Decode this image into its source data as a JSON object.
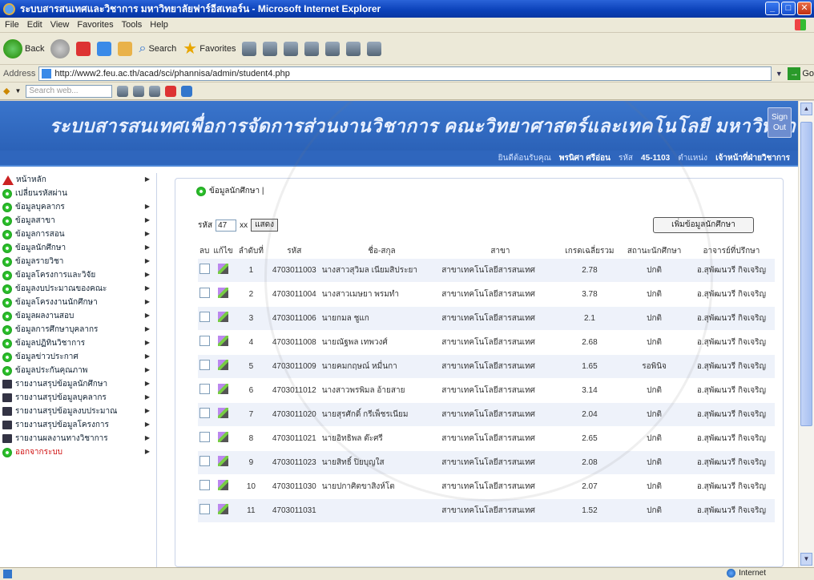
{
  "window": {
    "title": "ระบบสารสนเทศและวิชาการ มหาวิทยาลัยฟาร์อีสเทอร์น - Microsoft Internet Explorer"
  },
  "menu": [
    "File",
    "Edit",
    "View",
    "Favorites",
    "Tools",
    "Help"
  ],
  "toolbar": {
    "back": "Back",
    "search": "Search",
    "favorites": "Favorites"
  },
  "address": {
    "label": "Address",
    "url": "http://www2.feu.ac.th/acad/sci/phannisa/admin/student4.php",
    "go": "Go"
  },
  "searchbar": {
    "placeholder": "Search web..."
  },
  "status": {
    "zone": "Internet"
  },
  "site": {
    "title": "ระบบสารสนเทศเพื่อการจัดการส่วนงานวิชาการ คณะวิทยาศาสตร์และเทคโนโลยี มหาวิทยาลัยฟาร์อีสเทอร์น",
    "signout": "Sign Out"
  },
  "infobar": {
    "prefix": "ยินดีต้อนรับคุณ",
    "user": "พรนิศา ศรีอ่อน",
    "code_label": "รหัส",
    "code": "45-1103",
    "status_label": "ตำแหน่ง",
    "status": "เจ้าหน้าที่ฝ่ายวิชาการ"
  },
  "sidebar": [
    {
      "label": "หน้าหลัก",
      "icon": "home",
      "arrow": true
    },
    {
      "label": "เปลี่ยนรหัสผ่าน",
      "icon": "dot",
      "arrow": false
    },
    {
      "label": "ข้อมูลบุคลากร",
      "icon": "dot",
      "arrow": true
    },
    {
      "label": "ข้อมูลสาขา",
      "icon": "dot",
      "arrow": true
    },
    {
      "label": "ข้อมูลการสอน",
      "icon": "dot",
      "arrow": true
    },
    {
      "label": "ข้อมูลนักศึกษา",
      "icon": "dot",
      "arrow": true
    },
    {
      "label": "ข้อมูลรายวิชา",
      "icon": "dot",
      "arrow": true
    },
    {
      "label": "ข้อมูลโครงการและวิจัย",
      "icon": "dot",
      "arrow": true
    },
    {
      "label": "ข้อมูลงบประมาณของคณะ",
      "icon": "dot",
      "arrow": true
    },
    {
      "label": "ข้อมูลโครงงานนักศึกษา",
      "icon": "dot",
      "arrow": true
    },
    {
      "label": "ข้อมูลผลงานสอบ",
      "icon": "dot",
      "arrow": true
    },
    {
      "label": "ข้อมูลการศึกษาบุคลากร",
      "icon": "dot",
      "arrow": true
    },
    {
      "label": "ข้อมูลปฏิทินวิชาการ",
      "icon": "dot",
      "arrow": true
    },
    {
      "label": "ข้อมูลข่าวประกาศ",
      "icon": "dot",
      "arrow": true
    },
    {
      "label": "ข้อมูลประกันคุณภาพ",
      "icon": "dot",
      "arrow": true
    },
    {
      "label": "รายงานสรุปข้อมูลนักศึกษา",
      "icon": "book",
      "arrow": true
    },
    {
      "label": "รายงานสรุปข้อมูลบุคลากร",
      "icon": "book",
      "arrow": true
    },
    {
      "label": "รายงานสรุปข้อมูลงบประมาณ",
      "icon": "book",
      "arrow": true
    },
    {
      "label": "รายงานสรุปข้อมูลโครงการ",
      "icon": "book",
      "arrow": true
    },
    {
      "label": "รายงานผลงานทางวิชาการ",
      "icon": "book",
      "arrow": true
    },
    {
      "label": "ออกจากระบบ",
      "icon": "dot",
      "arrow": true,
      "red": true
    }
  ],
  "main": {
    "breadcrumb": "ข้อมูลนักศึกษา |",
    "filter": {
      "label": "รหัส",
      "year": "47",
      "suffix": "xx",
      "button": "แสดง"
    },
    "add_button": "เพิ่มข้อมูลนักศึกษา",
    "columns": [
      "ลบ",
      "แก้ไข",
      "ลำดับที่",
      "รหัส",
      "ชื่อ-สกุล",
      "สาขา",
      "เกรดเฉลี่ยรวม",
      "สถานะนักศึกษา",
      "อาจารย์ที่ปรึกษา"
    ],
    "rows": [
      {
        "no": "1",
        "id": "4703011003",
        "name": "นางสาวสุวิมล เนียมสิประยา",
        "major": "สาขาเทคโนโลยีสารสนเทศ",
        "gpa": "2.78",
        "status": "ปกติ",
        "advisor": "อ.สุพัฒนวรี กิจเจริญ"
      },
      {
        "no": "2",
        "id": "4703011004",
        "name": "นางสาวเมษยา พรมทำ",
        "major": "สาขาเทคโนโลยีสารสนเทศ",
        "gpa": "3.78",
        "status": "ปกติ",
        "advisor": "อ.สุพัฒนวรี กิจเจริญ"
      },
      {
        "no": "3",
        "id": "4703011006",
        "name": "นายกมล ชูแก",
        "major": "สาขาเทคโนโลยีสารสนเทศ",
        "gpa": "2.1",
        "status": "ปกติ",
        "advisor": "อ.สุพัฒนวรี กิจเจริญ"
      },
      {
        "no": "4",
        "id": "4703011008",
        "name": "นายณัฐพล เทพวงศ์",
        "major": "สาขาเทคโนโลยีสารสนเทศ",
        "gpa": "2.68",
        "status": "ปกติ",
        "advisor": "อ.สุพัฒนวรี กิจเจริญ"
      },
      {
        "no": "5",
        "id": "4703011009",
        "name": "นายคมกฤษณ์ หมื่นกา",
        "major": "สาขาเทคโนโลยีสารสนเทศ",
        "gpa": "1.65",
        "status": "รอพินิจ",
        "advisor": "อ.สุพัฒนวรี กิจเจริญ"
      },
      {
        "no": "6",
        "id": "4703011012",
        "name": "นางสาวพรพิมล อ้ายสาย",
        "major": "สาขาเทคโนโลยีสารสนเทศ",
        "gpa": "3.14",
        "status": "ปกติ",
        "advisor": "อ.สุพัฒนวรี กิจเจริญ"
      },
      {
        "no": "7",
        "id": "4703011020",
        "name": "นายสุรศักดิ์ กรีเพ็ชรเนียม",
        "major": "สาขาเทคโนโลยีสารสนเทศ",
        "gpa": "2.04",
        "status": "ปกติ",
        "advisor": "อ.สุพัฒนวรี กิจเจริญ"
      },
      {
        "no": "8",
        "id": "4703011021",
        "name": "นายอิทธิพล ต๊ะศรี",
        "major": "สาขาเทคโนโลยีสารสนเทศ",
        "gpa": "2.65",
        "status": "ปกติ",
        "advisor": "อ.สุพัฒนวรี กิจเจริญ"
      },
      {
        "no": "9",
        "id": "4703011023",
        "name": "นายสิทธิ์ ปิยบุญใส",
        "major": "สาขาเทคโนโลยีสารสนเทศ",
        "gpa": "2.08",
        "status": "ปกติ",
        "advisor": "อ.สุพัฒนวรี กิจเจริญ"
      },
      {
        "no": "10",
        "id": "4703011030",
        "name": "นายปกาศิตขาสิงห์โต",
        "major": "สาขาเทคโนโลยีสารสนเทศ",
        "gpa": "2.07",
        "status": "ปกติ",
        "advisor": "อ.สุพัฒนวรี กิจเจริญ"
      },
      {
        "no": "11",
        "id": "4703011031",
        "name": "",
        "major": "สาขาเทคโนโลยีสารสนเทศ",
        "gpa": "1.52",
        "status": "ปกติ",
        "advisor": "อ.สุพัฒนวรี กิจเจริญ"
      }
    ]
  }
}
